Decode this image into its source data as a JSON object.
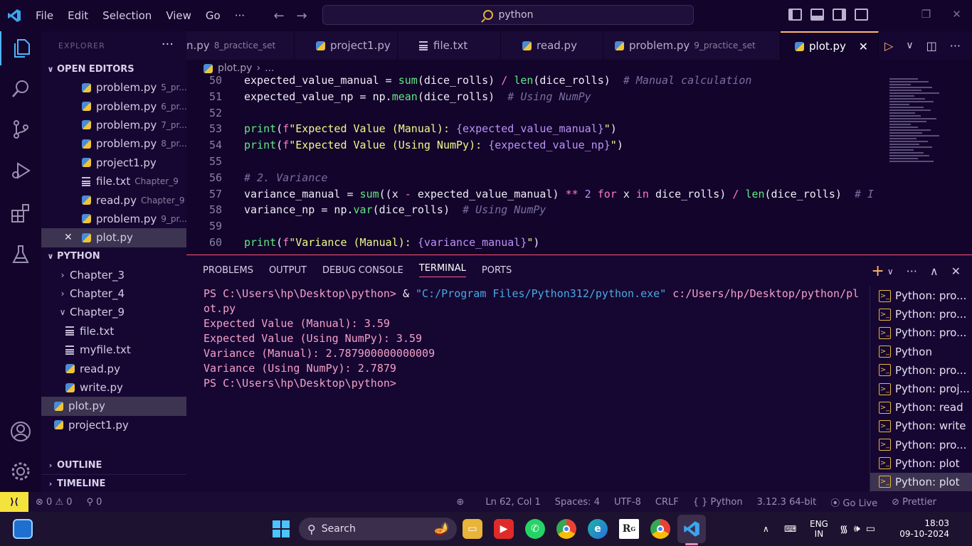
{
  "menu": {
    "items": [
      "File",
      "Edit",
      "Selection",
      "View",
      "Go"
    ],
    "more": "···"
  },
  "search": {
    "text": "python"
  },
  "sidebar": {
    "header": "EXPLORER",
    "open_editors_title": "OPEN EDITORS",
    "open_editors": [
      {
        "name": "problem.py",
        "hint": "5_pr...",
        "icon": "python-file-icon"
      },
      {
        "name": "problem.py",
        "hint": "6_pr...",
        "icon": "python-file-icon"
      },
      {
        "name": "problem.py",
        "hint": "7_pr...",
        "icon": "python-file-icon"
      },
      {
        "name": "problem.py",
        "hint": "8_pr...",
        "icon": "python-file-icon"
      },
      {
        "name": "project1.py",
        "hint": "",
        "icon": "python-file-icon"
      },
      {
        "name": "file.txt",
        "hint": "Chapter_9",
        "icon": "text-file-icon"
      },
      {
        "name": "read.py",
        "hint": "Chapter_9",
        "icon": "python-file-icon"
      },
      {
        "name": "problem.py",
        "hint": "9_pr...",
        "icon": "python-file-icon"
      },
      {
        "name": "plot.py",
        "hint": "",
        "icon": "python-file-icon"
      }
    ],
    "workspace_title": "PYTHON",
    "tree": [
      {
        "name": "Chapter_3",
        "type": "folder"
      },
      {
        "name": "Chapter_4",
        "type": "folder"
      },
      {
        "name": "Chapter_9",
        "type": "folder-open"
      },
      {
        "name": "file.txt",
        "type": "txt"
      },
      {
        "name": "myfile.txt",
        "type": "txt"
      },
      {
        "name": "read.py",
        "type": "py"
      },
      {
        "name": "write.py",
        "type": "py"
      },
      {
        "name": "plot.py",
        "type": "py-root"
      },
      {
        "name": "project1.py",
        "type": "py-root"
      }
    ],
    "outline_title": "OUTLINE",
    "timeline_title": "TIMELINE"
  },
  "tabs": [
    {
      "name": "n.py",
      "hint": "8_practice_set"
    },
    {
      "name": "project1.py",
      "hint": ""
    },
    {
      "name": "file.txt",
      "hint": ""
    },
    {
      "name": "read.py",
      "hint": ""
    },
    {
      "name": "problem.py",
      "hint": "9_practice_set"
    },
    {
      "name": "plot.py",
      "hint": ""
    }
  ],
  "breadcrumb": {
    "file": "plot.py",
    "rest": "..."
  },
  "editor": {
    "lines": [
      {
        "n": "50",
        "html": "expected_value_manual = <span class='tk-fn'>sum</span>(dice_rolls) <span class='tk-op'>/</span> <span class='tk-fn'>len</span>(dice_rolls)  <span class='tk-com'># Manual calculation</span>"
      },
      {
        "n": "51",
        "html": "expected_value_np = np.<span class='tk-fn'>mean</span>(dice_rolls)  <span class='tk-com'># Using NumPy</span>"
      },
      {
        "n": "52",
        "html": ""
      },
      {
        "n": "53",
        "html": "<span class='tk-fn'>print</span>(<span class='tk-kw'>f</span><span class='tk-str'>\"Expected Value (Manual): </span><span class='tk-var'>{expected_value_manual}</span><span class='tk-str'>\"</span>)"
      },
      {
        "n": "54",
        "html": "<span class='tk-fn'>print</span>(<span class='tk-kw'>f</span><span class='tk-str'>\"Expected Value (Using NumPy): </span><span class='tk-var'>{expected_value_np}</span><span class='tk-str'>\"</span>)"
      },
      {
        "n": "55",
        "html": ""
      },
      {
        "n": "56",
        "html": "<span class='tk-com'># 2. Variance</span>"
      },
      {
        "n": "57",
        "html": "variance_manual = <span class='tk-fn'>sum</span>((x <span class='tk-op'>-</span> expected_value_manual) <span class='tk-op'>**</span> <span class='tk-num'>2</span> <span class='tk-kw'>for</span> x <span class='tk-kw'>in</span> dice_rolls) <span class='tk-op'>/</span> <span class='tk-fn'>len</span>(dice_rolls)  <span class='tk-com'># I</span>"
      },
      {
        "n": "58",
        "html": "variance_np = np.<span class='tk-fn'>var</span>(dice_rolls)  <span class='tk-com'># Using NumPy</span>"
      },
      {
        "n": "59",
        "html": ""
      },
      {
        "n": "60",
        "html": "<span class='tk-fn'>print</span>(<span class='tk-kw'>f</span><span class='tk-str'>\"Variance (Manual): </span><span class='tk-var'>{variance_manual}</span><span class='tk-str'>\"</span>)"
      }
    ]
  },
  "panel": {
    "tabs": [
      "PROBLEMS",
      "OUTPUT",
      "DEBUG CONSOLE",
      "TERMINAL",
      "PORTS"
    ],
    "active_tab": "TERMINAL",
    "terminal": {
      "cmd_prompt": "PS C:\\Users\\hp\\Desktop\\python> ",
      "cmd_amp": "& ",
      "cmd_exe": "\"C:/Program Files/Python312/python.exe\"",
      "cmd_arg1": " c:/Users/hp/Desktop/python/pl",
      "cmd_arg2": "ot.py",
      "output": [
        "Expected Value (Manual): 3.59",
        "Expected Value (Using NumPy): 3.59",
        "Variance (Manual): 2.787900000000009",
        "Variance (Using NumPy): 2.7879"
      ],
      "final_prompt": "PS C:\\Users\\hp\\Desktop\\python>"
    },
    "terminal_list": [
      "Python: pro...",
      "Python: pro...",
      "Python: pro...",
      "Python",
      "Python: pro...",
      "Python: proj...",
      "Python: read",
      "Python: write",
      "Python: pro...",
      "Python: plot",
      "Python: plot"
    ]
  },
  "status": {
    "errors": "0",
    "warnings": "0",
    "ports": "0",
    "position": "Ln 62, Col 1",
    "spaces": "Spaces: 4",
    "encoding": "UTF-8",
    "eol": "CRLF",
    "language": "Python",
    "interpreter": "3.12.3 64-bit",
    "golive": "Go Live",
    "prettier": "Prettier"
  },
  "taskbar": {
    "search": "Search",
    "lang1": "ENG",
    "lang2": "IN",
    "time": "18:03",
    "date": "09-10-2024"
  }
}
